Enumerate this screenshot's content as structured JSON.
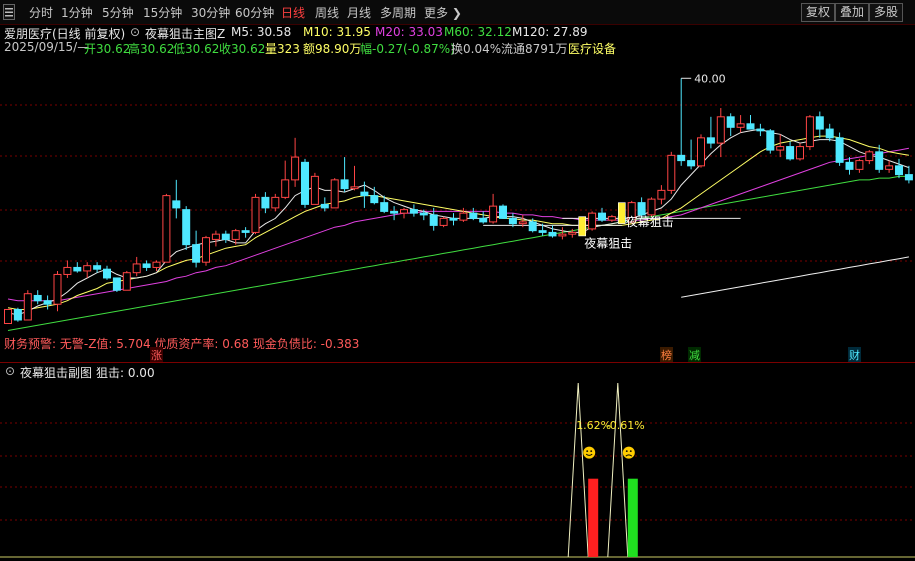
{
  "toolbar": {
    "icon": "menu-toggle-icon",
    "periods": [
      "分时",
      "1分钟",
      "5分钟",
      "15分钟",
      "30分钟",
      "60分钟",
      "日线",
      "周线",
      "月线",
      "多周期",
      "更多"
    ],
    "active_period": "日线",
    "right_buttons": [
      "复权",
      "叠加",
      "多股"
    ]
  },
  "colors": {
    "up": "#ff4545",
    "down": "#4fe8ff",
    "ma5": "#e8e8e8",
    "ma10": "#ffff66",
    "ma20": "#e040e0",
    "ma60": "#40dd40",
    "ma120": "#f0f0f0",
    "grid": "#7a0000",
    "signal": "#ffee33"
  },
  "header": {
    "stock_title": "爱朋医疗(日线 前复权)",
    "indicator_name": "夜幕狙击主图Z",
    "ma5": "M5: 30.58",
    "ma10": "M10: 31.95",
    "ma20": "M20: 33.03",
    "ma60": "M60: 32.12",
    "ma120": "M120: 27.89"
  },
  "quote": {
    "date": "2025/09/15/—",
    "open": "开30.62",
    "high": "高30.62",
    "low": "低30.62",
    "close": "收30.62",
    "volume": "量323",
    "amount": "额98.90万",
    "change": "幅-0.27(-0.87%)",
    "turnover": "换0.04%",
    "float": "流通8791万",
    "sector": "医疗设备"
  },
  "finance_line": "财务预警: 无警-Z值: 5.704 优质资产率: 0.68 现金负债比: -0.383",
  "events": [
    "涨",
    "榜",
    "减",
    "财"
  ],
  "chart_data": [
    {
      "type": "candlestick",
      "title": "夜幕狙击主图Z",
      "ohlc": [
        [
          26.0,
          26.8,
          26.0,
          26.8
        ],
        [
          26.8,
          26.9,
          26.1,
          26.2
        ],
        [
          26.2,
          27.9,
          26.2,
          27.7
        ],
        [
          27.6,
          27.9,
          27.1,
          27.3
        ],
        [
          27.3,
          27.6,
          26.8,
          27.1
        ],
        [
          27.1,
          29.0,
          26.7,
          28.8
        ],
        [
          28.8,
          29.6,
          28.6,
          29.2
        ],
        [
          29.2,
          29.5,
          28.9,
          29.0
        ],
        [
          29.0,
          29.5,
          28.6,
          29.3
        ],
        [
          29.3,
          29.5,
          28.9,
          29.1
        ],
        [
          29.1,
          29.3,
          28.5,
          28.6
        ],
        [
          28.6,
          28.6,
          27.8,
          27.9
        ],
        [
          27.9,
          29.0,
          27.9,
          28.9
        ],
        [
          28.9,
          29.8,
          28.7,
          29.4
        ],
        [
          29.4,
          29.6,
          29.0,
          29.2
        ],
        [
          29.2,
          29.6,
          29.0,
          29.5
        ],
        [
          29.5,
          33.4,
          29.5,
          33.3
        ],
        [
          33.0,
          34.2,
          32.0,
          32.6
        ],
        [
          32.5,
          32.7,
          30.2,
          30.5
        ],
        [
          30.5,
          31.3,
          29.2,
          29.5
        ],
        [
          29.5,
          31.0,
          29.3,
          30.9
        ],
        [
          30.8,
          31.3,
          30.4,
          31.1
        ],
        [
          31.1,
          31.3,
          30.6,
          30.8
        ],
        [
          30.8,
          31.4,
          30.5,
          31.3
        ],
        [
          31.3,
          31.5,
          30.9,
          31.2
        ],
        [
          31.2,
          33.4,
          31.1,
          33.2
        ],
        [
          33.2,
          33.5,
          32.3,
          32.6
        ],
        [
          32.6,
          33.4,
          32.4,
          33.2
        ],
        [
          33.2,
          35.3,
          33.1,
          34.2
        ],
        [
          34.2,
          36.6,
          33.8,
          35.5
        ],
        [
          35.2,
          35.4,
          32.6,
          32.8
        ],
        [
          32.8,
          34.6,
          32.8,
          34.4
        ],
        [
          32.8,
          33.2,
          32.4,
          32.6
        ],
        [
          32.6,
          34.3,
          32.6,
          34.2
        ],
        [
          34.2,
          35.5,
          33.5,
          33.7
        ],
        [
          33.7,
          35.0,
          33.6,
          33.8
        ],
        [
          33.5,
          34.1,
          32.6,
          33.3
        ],
        [
          33.3,
          33.8,
          32.8,
          32.9
        ],
        [
          32.9,
          33.3,
          32.3,
          32.4
        ],
        [
          32.4,
          32.7,
          31.9,
          32.3
        ],
        [
          32.3,
          32.6,
          32.0,
          32.5
        ],
        [
          32.5,
          32.8,
          32.1,
          32.3
        ],
        [
          32.3,
          32.5,
          31.9,
          32.2
        ],
        [
          32.2,
          32.6,
          31.3,
          31.6
        ],
        [
          31.6,
          32.1,
          31.5,
          32.0
        ],
        [
          32.0,
          32.3,
          31.6,
          31.9
        ],
        [
          31.9,
          32.6,
          31.8,
          32.3
        ],
        [
          32.3,
          32.6,
          31.9,
          32.0
        ],
        [
          32.0,
          32.4,
          31.7,
          31.8
        ],
        [
          31.8,
          33.4,
          31.7,
          32.7
        ],
        [
          32.7,
          32.8,
          32.0,
          32.0
        ],
        [
          32.0,
          32.3,
          31.5,
          31.7
        ],
        [
          31.7,
          32.2,
          31.5,
          31.8
        ],
        [
          31.8,
          32.0,
          31.2,
          31.3
        ],
        [
          31.3,
          31.7,
          31.0,
          31.2
        ],
        [
          31.2,
          31.6,
          30.9,
          31.0
        ],
        [
          31.0,
          31.5,
          30.8,
          31.1
        ],
        [
          31.1,
          31.4,
          30.9,
          31.2
        ],
        [
          31.2,
          31.8,
          31.0,
          31.6
        ],
        [
          31.4,
          32.4,
          31.3,
          32.3
        ],
        [
          32.3,
          32.6,
          31.8,
          31.9
        ],
        [
          31.9,
          32.2,
          31.8,
          32.1
        ],
        [
          32.1,
          32.2,
          31.7,
          31.8
        ],
        [
          31.8,
          33.0,
          31.7,
          32.9
        ],
        [
          32.9,
          33.2,
          32.0,
          32.2
        ],
        [
          32.2,
          33.2,
          32.1,
          33.1
        ],
        [
          33.1,
          33.9,
          32.8,
          33.6
        ],
        [
          33.6,
          35.8,
          33.4,
          35.6
        ],
        [
          35.6,
          40.0,
          35.0,
          35.3
        ],
        [
          35.3,
          36.5,
          34.8,
          35.0
        ],
        [
          35.0,
          36.8,
          34.9,
          36.6
        ],
        [
          36.6,
          37.8,
          36.0,
          36.3
        ],
        [
          36.3,
          38.3,
          35.5,
          37.8
        ],
        [
          37.8,
          38.0,
          36.7,
          37.2
        ],
        [
          37.2,
          37.9,
          36.9,
          37.4
        ],
        [
          37.4,
          37.9,
          37.1,
          37.1
        ],
        [
          37.1,
          37.4,
          36.7,
          37.0
        ],
        [
          37.0,
          37.1,
          35.7,
          35.9
        ],
        [
          35.9,
          36.8,
          35.5,
          36.1
        ],
        [
          36.1,
          36.4,
          35.3,
          35.4
        ],
        [
          35.4,
          36.3,
          35.3,
          36.1
        ],
        [
          36.1,
          37.9,
          35.9,
          37.8
        ],
        [
          37.8,
          38.1,
          36.6,
          37.1
        ],
        [
          37.1,
          37.4,
          36.4,
          36.6
        ],
        [
          36.6,
          36.9,
          35.0,
          35.2
        ],
        [
          35.2,
          35.5,
          34.5,
          34.8
        ],
        [
          34.8,
          35.4,
          34.6,
          35.3
        ],
        [
          35.3,
          35.9,
          35.1,
          35.8
        ],
        [
          35.8,
          36.2,
          34.6,
          34.8
        ],
        [
          34.8,
          35.3,
          34.6,
          35.0
        ],
        [
          35.0,
          35.4,
          34.3,
          34.5
        ],
        [
          34.5,
          35.0,
          34.0,
          34.2
        ]
      ],
      "ma5": [
        26.6,
        26.5,
        26.7,
        27.0,
        27.2,
        27.4,
        27.8,
        28.3,
        28.6,
        28.9,
        29.1,
        28.8,
        28.6,
        28.6,
        28.7,
        28.9,
        29.6,
        30.1,
        30.3,
        30.5,
        30.6,
        30.7,
        30.8,
        30.6,
        30.6,
        31.3,
        31.7,
        32.0,
        32.6,
        33.3,
        33.6,
        33.8,
        33.6,
        33.6,
        33.5,
        33.7,
        33.9,
        33.6,
        33.2,
        32.9,
        32.7,
        32.5,
        32.4,
        32.2,
        32.1,
        32.0,
        32.0,
        32.0,
        32.0,
        32.1,
        32.1,
        32.1,
        32.0,
        31.8,
        31.6,
        31.4,
        31.3,
        31.2,
        31.2,
        31.5,
        31.6,
        31.7,
        31.8,
        32.0,
        32.2,
        32.4,
        32.6,
        33.1,
        33.9,
        34.5,
        35.1,
        35.7,
        36.2,
        36.6,
        36.9,
        37.0,
        37.1,
        36.9,
        36.8,
        36.5,
        36.3,
        36.4,
        36.5,
        36.5,
        36.4,
        36.1,
        35.8,
        35.6,
        35.5,
        35.3,
        35.1,
        34.9
      ],
      "ma10": [
        26.9,
        26.8,
        26.8,
        26.9,
        27.0,
        27.1,
        27.3,
        27.6,
        27.8,
        28.0,
        28.3,
        28.4,
        28.5,
        28.6,
        28.7,
        28.9,
        29.2,
        29.4,
        29.6,
        29.7,
        29.9,
        30.1,
        30.3,
        30.4,
        30.5,
        30.9,
        31.2,
        31.5,
        31.8,
        32.1,
        32.4,
        32.6,
        32.8,
        32.9,
        33.0,
        33.2,
        33.3,
        33.3,
        33.2,
        33.1,
        33.0,
        32.9,
        32.8,
        32.7,
        32.6,
        32.5,
        32.4,
        32.3,
        32.2,
        32.1,
        32.0,
        32.0,
        31.9,
        31.9,
        31.8,
        31.7,
        31.7,
        31.6,
        31.6,
        31.6,
        31.6,
        31.6,
        31.6,
        31.7,
        31.8,
        31.9,
        32.0,
        32.3,
        32.6,
        33.0,
        33.4,
        33.8,
        34.2,
        34.6,
        35.0,
        35.4,
        35.8,
        36.1,
        36.3,
        36.4,
        36.5,
        36.6,
        36.7,
        36.7,
        36.6,
        36.5,
        36.3,
        36.1,
        36.0,
        35.8,
        35.7,
        35.6
      ],
      "ma20": [
        27.4,
        27.3,
        27.3,
        27.3,
        27.3,
        27.3,
        27.4,
        27.5,
        27.6,
        27.7,
        27.8,
        27.9,
        28.0,
        28.1,
        28.2,
        28.3,
        28.4,
        28.6,
        28.7,
        28.9,
        29.0,
        29.2,
        29.3,
        29.5,
        29.7,
        29.9,
        30.1,
        30.3,
        30.5,
        30.7,
        30.9,
        31.1,
        31.3,
        31.5,
        31.6,
        31.8,
        31.9,
        32.0,
        32.1,
        32.2,
        32.3,
        32.3,
        32.4,
        32.4,
        32.4,
        32.4,
        32.4,
        32.4,
        32.4,
        32.4,
        32.3,
        32.3,
        32.2,
        32.2,
        32.1,
        32.1,
        32.0,
        32.0,
        31.9,
        31.9,
        31.9,
        31.9,
        31.9,
        31.9,
        31.9,
        32.0,
        32.0,
        32.1,
        32.2,
        32.4,
        32.6,
        32.8,
        33.0,
        33.2,
        33.4,
        33.6,
        33.8,
        34.0,
        34.2,
        34.4,
        34.6,
        34.8,
        35.0,
        35.2,
        35.3,
        35.4,
        35.5,
        35.6,
        35.7,
        35.8,
        35.9,
        36.0
      ],
      "ma60": [
        25.6,
        25.7,
        25.8,
        25.9,
        26.0,
        26.1,
        26.2,
        26.3,
        26.4,
        26.5,
        26.6,
        26.7,
        26.8,
        26.9,
        27.0,
        27.1,
        27.2,
        27.3,
        27.4,
        27.5,
        27.6,
        27.7,
        27.8,
        27.9,
        28.0,
        28.1,
        28.2,
        28.3,
        28.4,
        28.5,
        28.6,
        28.7,
        28.8,
        28.9,
        29.0,
        29.1,
        29.2,
        29.3,
        29.4,
        29.5,
        29.6,
        29.7,
        29.8,
        29.9,
        30.0,
        30.1,
        30.2,
        30.3,
        30.4,
        30.5,
        30.6,
        30.7,
        30.8,
        30.9,
        31.0,
        31.1,
        31.2,
        31.3,
        31.4,
        31.5,
        31.6,
        31.7,
        31.8,
        31.9,
        32.0,
        32.1,
        32.2,
        32.3,
        32.4,
        32.5,
        32.6,
        32.7,
        32.8,
        32.9,
        33.0,
        33.1,
        33.2,
        33.3,
        33.4,
        33.5,
        33.6,
        33.7,
        33.8,
        33.9,
        34.0,
        34.1,
        34.2,
        34.2,
        34.3,
        34.3,
        34.4,
        34.4
      ],
      "ma120": [
        null,
        null,
        null,
        null,
        null,
        null,
        null,
        null,
        null,
        null,
        null,
        null,
        null,
        null,
        null,
        null,
        null,
        null,
        null,
        null,
        null,
        null,
        null,
        null,
        null,
        null,
        null,
        null,
        null,
        null,
        null,
        null,
        null,
        null,
        null,
        null,
        null,
        null,
        null,
        null,
        null,
        null,
        null,
        null,
        null,
        null,
        null,
        null,
        null,
        null,
        null,
        null,
        null,
        null,
        null,
        null,
        null,
        null,
        null,
        null,
        null,
        null,
        null,
        null,
        null,
        null,
        null,
        null,
        27.5,
        27.6,
        27.7,
        27.8,
        27.9,
        28.0,
        28.1,
        28.2,
        28.3,
        28.4,
        28.5,
        28.6,
        28.7,
        28.8,
        28.9,
        29.0,
        29.1,
        29.2,
        29.3,
        29.4,
        29.5,
        29.6,
        29.7,
        29.8
      ],
      "signal_bars": [
        {
          "index": 58,
          "low": 31.0,
          "high": 32.1
        },
        {
          "index": 62,
          "low": 31.7,
          "high": 32.9
        }
      ],
      "signal_labels": [
        "夜幕狙击",
        "夜幕狙击"
      ],
      "support_lines": [
        {
          "from": 48,
          "to": 62,
          "value": 31.6
        },
        {
          "from": 56,
          "to": 74,
          "value": 32.0
        }
      ],
      "max_label": "40.00",
      "ylim": [
        25.4,
        41.5
      ],
      "grid": true
    },
    {
      "type": "bar",
      "title": "夜幕狙击副图",
      "value_label": "狙击: 0.00",
      "spikes": [
        {
          "index": 58,
          "value": 1.0
        },
        {
          "index": 62,
          "value": 1.0
        }
      ],
      "bars": [
        {
          "index": 58,
          "value": 0.45,
          "color": "red"
        },
        {
          "index": 62,
          "value": 0.45,
          "color": "green"
        }
      ],
      "annotations": [
        "1.62%",
        "-0.61%"
      ],
      "face_icons": [
        "smile-face-icon",
        "sad-face-icon"
      ],
      "ylim": [
        0,
        1.0
      ],
      "grid": true
    }
  ]
}
